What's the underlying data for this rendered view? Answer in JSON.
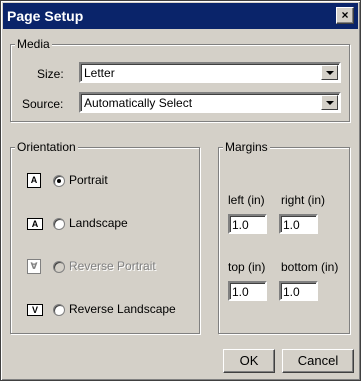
{
  "window": {
    "title": "Page Setup",
    "close_glyph": "×"
  },
  "media": {
    "label": "Media",
    "size_label": "Size:",
    "size_value": "Letter",
    "source_label": "Source:",
    "source_value": "Automatically Select"
  },
  "orientation": {
    "label": "Orientation",
    "options": [
      {
        "label": "Portrait",
        "icon": "A",
        "checked": true,
        "enabled": true
      },
      {
        "label": "Landscape",
        "icon": "A",
        "checked": false,
        "enabled": true
      },
      {
        "label": "Reverse Portrait",
        "icon": "∀",
        "checked": false,
        "enabled": false
      },
      {
        "label": "Reverse Landscape",
        "icon": "V",
        "checked": false,
        "enabled": true
      }
    ]
  },
  "margins": {
    "label": "Margins",
    "left_label": "left (in)",
    "left_value": "1.0",
    "right_label": "right (in)",
    "right_value": "1.0",
    "top_label": "top (in)",
    "top_value": "1.0",
    "bottom_label": "bottom (in)",
    "bottom_value": "1.0"
  },
  "buttons": {
    "ok": "OK",
    "cancel": "Cancel"
  }
}
